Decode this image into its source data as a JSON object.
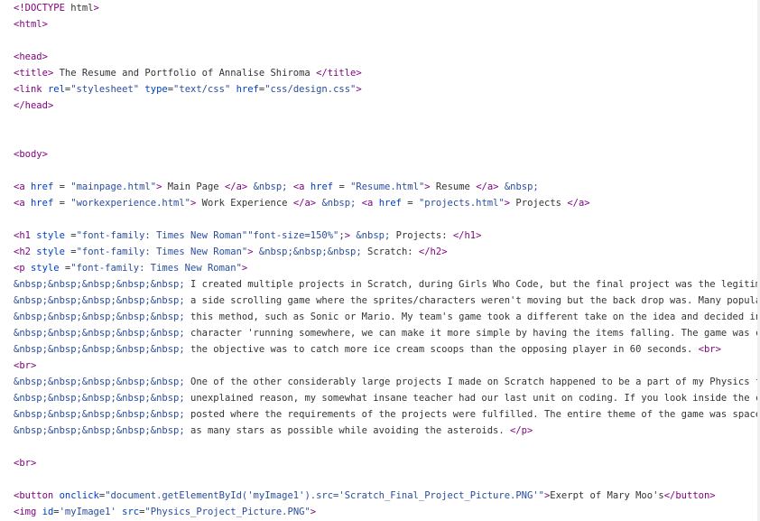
{
  "lines": [
    "<!DOCTYPE html>",
    "<html>",
    "",
    "<head>",
    "<title> The Resume and Portfolio of Annalise Shiroma </title>",
    "<link rel=\"stylesheet\" type=\"text/css\" href=\"css/design.css\">",
    "</head>",
    "",
    "",
    "<body>",
    "",
    "<a href = \"mainpage.html\"> Main Page </a> &nbsp; <a href = \"Resume.html\"> Resume </a> &nbsp;",
    "<a href = \"workexperience.html\"> Work Experience </a> &nbsp; <a href = \"projects.html\"> Projects </a>",
    "",
    "<h1 style =\"font-family: Times New Roman\"\"font-size=150%\";> &nbsp; Projects: </h1>",
    "<h2 style =\"font-family: Times New Roman\"> &nbsp;&nbsp;&nbsp; Scratch: </h2>",
    "<p style =\"font-family: Times New Roman\">",
    "&nbsp;&nbsp;&nbsp;&nbsp;&nbsp; I created multiple projects in Scratch, during Girls Who Code, but the final project was the legitimate one.",
    "&nbsp;&nbsp;&nbsp;&nbsp;&nbsp; a side scrolling game where the sprites/characters weren't moving but the back drop was. Many popular games",
    "&nbsp;&nbsp;&nbsp;&nbsp;&nbsp; this method, such as Sonic or Mario. My team's game took a different take on the idea and decided instead of",
    "&nbsp;&nbsp;&nbsp;&nbsp;&nbsp; character 'running somewhere, we can make it more simple by having the items falling. The game was called Mar",
    "&nbsp;&nbsp;&nbsp;&nbsp;&nbsp; the objective was to catch more ice cream scoops than the opposing player in 60 seconds. <br>",
    "<br>",
    "&nbsp;&nbsp;&nbsp;&nbsp;&nbsp; One of the other considerably large projects I made on Scratch happened to be a part of my Physics final. For",
    "&nbsp;&nbsp;&nbsp;&nbsp;&nbsp; unexplained reason, my somewhat insane teacher had our last unit on coding. If you look inside the code, ther",
    "&nbsp;&nbsp;&nbsp;&nbsp;&nbsp; posted where the requirements of the projects were fulfilled. The entire theme of the game was space. The goa",
    "&nbsp;&nbsp;&nbsp;&nbsp;&nbsp; as many stars as possible while avoiding the asteroids. </p>",
    "",
    "<br>",
    "",
    "<button onclick=\"document.getElementById('myImage1').src='Scratch_Final_Project_Picture.PNG'\">Exerpt of Mary Moo's</button>",
    "<img id='myImage1' src=\"Physics_Project_Picture.PNG\">"
  ],
  "colors": {
    "tag": "#7f007f",
    "attribute": "#0040c0",
    "string": "#2a4d9b",
    "entity": "#2a4d9b",
    "text": "#333333",
    "background": "#ffffff"
  }
}
